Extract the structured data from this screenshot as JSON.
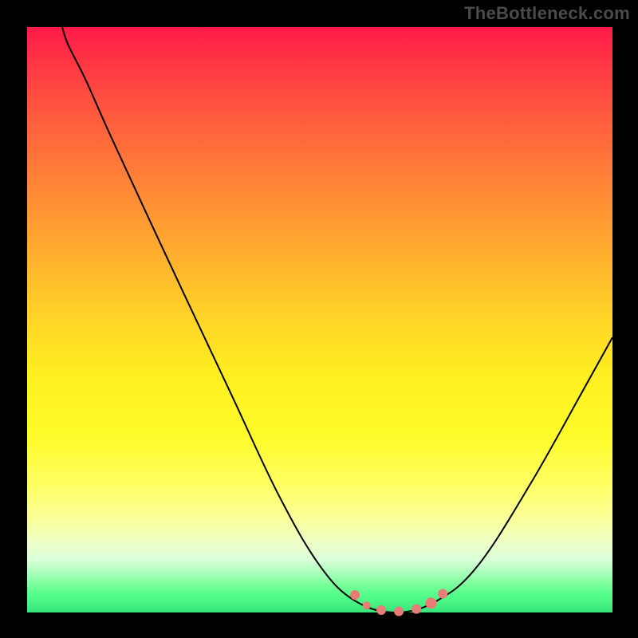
{
  "watermark": "TheBottleneck.com",
  "chart_data": {
    "type": "line",
    "title": "",
    "xlabel": "",
    "ylabel": "",
    "xlim": [
      0,
      100
    ],
    "ylim": [
      0,
      100
    ],
    "grid": false,
    "legend": false,
    "background": "rainbow-vertical-gradient",
    "series": [
      {
        "name": "bottleneck-curve",
        "color": "#000000",
        "points": [
          {
            "x": 6,
            "y": 100
          },
          {
            "x": 7,
            "y": 97
          },
          {
            "x": 10,
            "y": 91
          },
          {
            "x": 14,
            "y": 82
          },
          {
            "x": 20,
            "y": 69
          },
          {
            "x": 27,
            "y": 54
          },
          {
            "x": 35,
            "y": 37
          },
          {
            "x": 43,
            "y": 20
          },
          {
            "x": 50,
            "y": 8
          },
          {
            "x": 56,
            "y": 2
          },
          {
            "x": 63,
            "y": 0
          },
          {
            "x": 70,
            "y": 2
          },
          {
            "x": 77,
            "y": 8
          },
          {
            "x": 86,
            "y": 22
          },
          {
            "x": 95,
            "y": 38
          },
          {
            "x": 100,
            "y": 47
          }
        ]
      }
    ],
    "markers": [
      {
        "x": 56.0,
        "y": 3,
        "r": 6,
        "color": "#ea7b76"
      },
      {
        "x": 58.0,
        "y": 1.2,
        "r": 5,
        "color": "#ea7b76"
      },
      {
        "x": 60.5,
        "y": 0.4,
        "r": 6,
        "color": "#ea7b76"
      },
      {
        "x": 63.5,
        "y": 0.2,
        "r": 6,
        "color": "#ea7b76"
      },
      {
        "x": 66.5,
        "y": 0.6,
        "r": 6,
        "color": "#ea7b76"
      },
      {
        "x": 69.0,
        "y": 1.6,
        "r": 7,
        "color": "#ea7b76"
      },
      {
        "x": 71.0,
        "y": 3.2,
        "r": 6,
        "color": "#ea7b76"
      }
    ],
    "annotations": []
  }
}
